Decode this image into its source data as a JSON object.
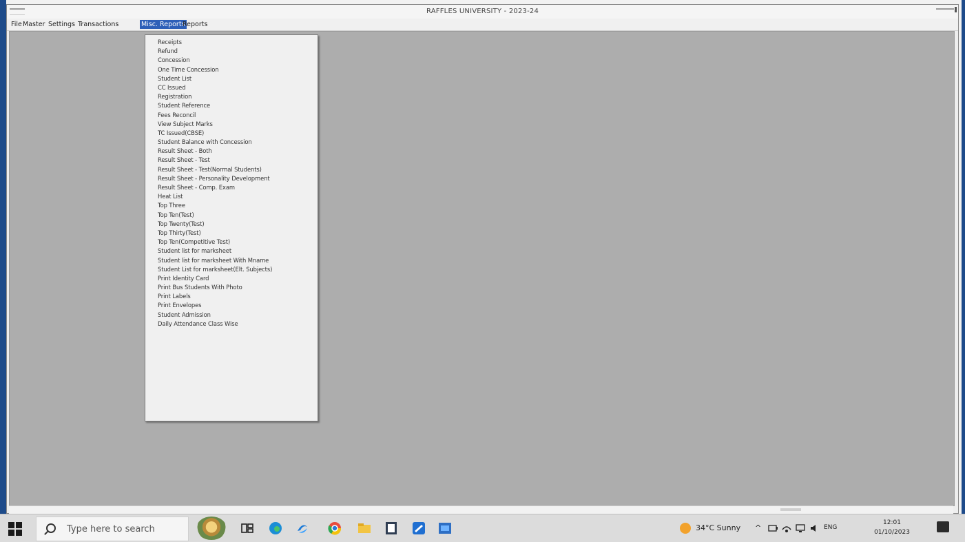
{
  "window": {
    "title": "RAFFLES UNIVERSITY - 2023-24"
  },
  "menubar": {
    "items": [
      "File",
      "Master",
      "Settings",
      "Transactions",
      "Misc. Reports",
      "Reports"
    ]
  },
  "misc_reports_menu": {
    "items": [
      "Receipts",
      "Refund",
      "Concession",
      "One Time Concession",
      "Student List",
      "CC Issued",
      "Registration",
      "Student Reference",
      "Fees Reconcil",
      "View Subject Marks",
      "TC Issued(CBSE)",
      "Student Balance with Concession",
      "Result Sheet - Both",
      "Result Sheet - Test",
      "Result Sheet - Test(Normal Students)",
      "Result Sheet - Personality Development",
      "Result Sheet - Comp. Exam",
      "Heat List",
      "Top Three",
      "Top Ten(Test)",
      "Top Twenty(Test)",
      "Top Thirty(Test)",
      "Top Ten(Competitive Test)",
      "Student list for marksheet",
      "Student list for marksheet With Mname",
      "Student List for marksheet(Elt. Subjects)",
      "Print Identity Card",
      "Print Bus Students With Photo",
      "Print Labels",
      "Print Envelopes",
      "Student Admission",
      "Daily Attendance Class Wise"
    ]
  },
  "taskbar": {
    "search_placeholder": "Type here to search",
    "weather": "34°C  Sunny",
    "language": "ENG",
    "time": "12:01",
    "date": "01/10/2023"
  },
  "colors": {
    "menu_highlight": "#2d5fb8",
    "client_bg": "#adadad",
    "window_frame": "#1e4b8a"
  }
}
